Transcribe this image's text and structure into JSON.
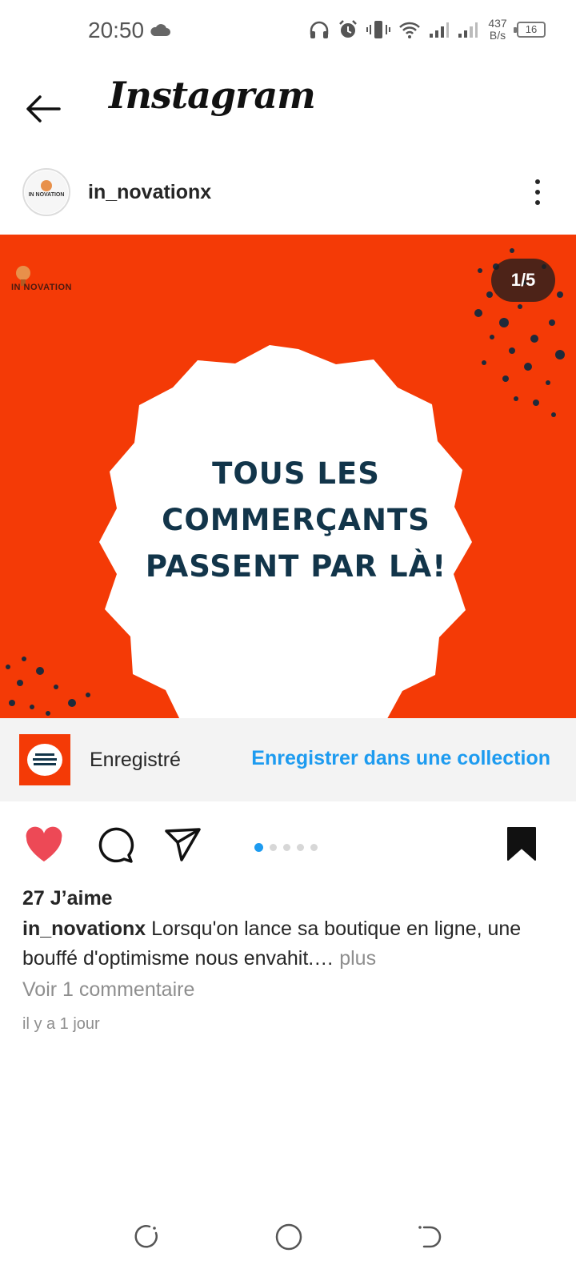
{
  "status_bar": {
    "time": "20:50",
    "net_speed_value": "437",
    "net_speed_unit": "B/s",
    "battery": "16"
  },
  "nav": {
    "app_title": "Instagram"
  },
  "post": {
    "username": "in_novationx",
    "slide_counter": "1/5",
    "slide_position": 1,
    "slide_total": 5,
    "brand_mark": "IN NOVATION",
    "headline_lines": [
      "TOUS LES",
      "COMMERÇANTS",
      "PASSENT PAR LÀ!"
    ],
    "saved_label": "Enregistré",
    "save_collection_label": "Enregistrer dans une collection",
    "liked": true,
    "bookmarked": true,
    "likes": "27 J’aime",
    "caption_user": "in_novationx",
    "caption_text": "Lorsqu'on lance sa boutique en ligne, une bouffé d'optimisme nous envahit.…",
    "caption_more": "plus",
    "view_comments": "Voir 1 commentaire",
    "time_ago": "il y a 1 jour"
  },
  "colors": {
    "post_bg": "#f43a06",
    "headline": "#12354a",
    "link_blue": "#1d9bf0",
    "like_red": "#ed4956"
  },
  "icons": {
    "back": "arrow-left-icon",
    "more": "three-dots-vertical-icon",
    "like": "heart-icon",
    "comment": "comment-bubble-icon",
    "share": "paper-plane-icon",
    "bookmark": "bookmark-icon"
  }
}
